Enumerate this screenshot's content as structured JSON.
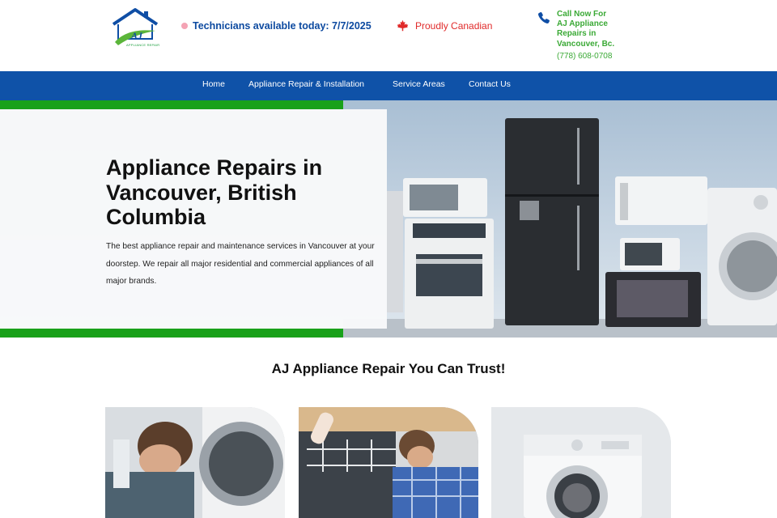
{
  "header": {
    "logo_text": "AJ",
    "logo_tagline": "APPLIANCE REPAIR",
    "availability": "Technicians available today: 7/7/2025",
    "canadian": "Proudly Canadian",
    "call_lines": [
      "Call Now For",
      "AJ Appliance",
      "Repairs in",
      "Vancouver, Bc."
    ],
    "phone": "(778) 608-0708"
  },
  "nav": {
    "items": [
      "Home",
      "Appliance Repair & Installation",
      "Service Areas",
      "Contact Us"
    ]
  },
  "hero": {
    "title": "Appliance Repairs in Vancouver, British Columbia",
    "description": "The best appliance repair and maintenance services in Vancouver at your doorstep. We repair all major residential and commercial appliances of all major brands."
  },
  "section": {
    "title": "AJ Appliance Repair You Can Trust!"
  },
  "icons": {
    "logo": "house-logo-icon",
    "availability": "status-dot-icon",
    "canadian": "maple-leaf-icon",
    "phone": "phone-icon"
  },
  "colors": {
    "nav_bg": "#0f52a8",
    "accent_green": "#19a11a",
    "availability_text": "#0d4aa0",
    "canadian_text": "#e02a2a",
    "call_text": "#3aa935"
  }
}
